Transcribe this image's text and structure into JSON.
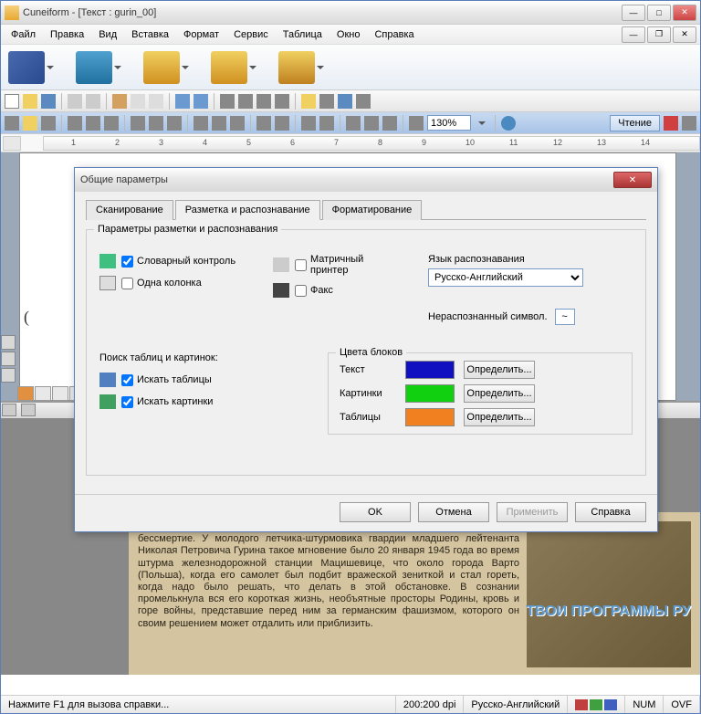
{
  "window": {
    "title": "Cuneiform - [Текст : gurin_00]"
  },
  "menu": {
    "file": "Файл",
    "edit": "Правка",
    "view": "Вид",
    "insert": "Вставка",
    "format": "Формат",
    "service": "Сервис",
    "table": "Таблица",
    "window": "Окно",
    "help": "Справка"
  },
  "toolbar": {
    "zoom": "130%",
    "read": "Чтение"
  },
  "ruler": {
    "u1": "1",
    "u2": "2",
    "u3": "3",
    "u4": "4",
    "u5": "5",
    "u6": "6",
    "u7": "7",
    "u8": "8",
    "u9": "9",
    "u10": "10",
    "u11": "11",
    "u12": "12",
    "u13": "13",
    "u14": "14"
  },
  "dialog": {
    "title": "Общие параметры",
    "tabs": {
      "scan": "Сканирование",
      "markup": "Разметка и распознавание",
      "format": "Форматирование"
    },
    "group_main": "Параметры разметки и распознавания",
    "spell": "Словарный контроль",
    "onecol": "Одна колонка",
    "matrix": "Матричный принтер",
    "fax": "Факс",
    "lang_label": "Язык распознавания",
    "lang_value": "Русско-Английский",
    "unknown_label": "Нераспознанный символ.",
    "unknown_value": "~",
    "search_label": "Поиск таблиц и картинок:",
    "search_tables": "Искать таблицы",
    "search_images": "Искать картинки",
    "colors_legend": "Цвета блоков",
    "c_text": "Текст",
    "c_text_hex": "#1010c0",
    "c_img": "Картинки",
    "c_img_hex": "#10d010",
    "c_tbl": "Таблицы",
    "c_tbl_hex": "#f08020",
    "define": "Определить...",
    "ok": "OK",
    "cancel": "Отмена",
    "apply": "Применить",
    "help": "Справка"
  },
  "scan": {
    "text": "В жизни людей бывают такие мгновения, которые кому несут позор, а кому бессмертие. У молодого летчика-штурмовика гвардии младшего лейтенанта Николая Петровича Гурина такое мгновение было 20 января 1945 года во время штурма железнодорожной станции Мацишевице, что около города Варто (Польша), когда его самолет был подбит вражеской зениткой и стал гореть, когда надо было решать, что делать в этой обстановке. В сознании промелькнула вся его короткая жизнь, необъятные просторы Родины, кровь и горе войны, представшие перед ним за германским фашизмом, которого он своим решением может отдалить или приблизить."
  },
  "watermark": "ТВОИ ПРОГРАММЫ РУ",
  "status": {
    "help": "Нажмите F1 для вызова справки...",
    "dpi": "200:200 dpi",
    "lang": "Русско-Английский",
    "num": "NUM",
    "ovf": "OVF"
  }
}
